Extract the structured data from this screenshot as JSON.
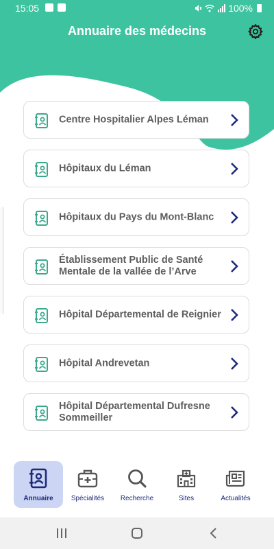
{
  "status_bar": {
    "time": "15:05",
    "battery": "100%"
  },
  "header": {
    "title": "Annuaire des médecins"
  },
  "colors": {
    "brand_green": "#3ec3a0",
    "navy": "#1e2a78",
    "icon_teal": "#3aa98b",
    "active_tab_bg": "#ccd5f3"
  },
  "hospitals": [
    {
      "label": "Centre Hospitalier Alpes Léman",
      "icon": "contact-book-icon"
    },
    {
      "label": "Hôpitaux du Léman",
      "icon": "contact-book-icon"
    },
    {
      "label": "Hôpitaux du Pays du Mont-Blanc",
      "icon": "contact-book-icon"
    },
    {
      "label": "Établissement Public de Santé Mentale de la vallée de l’Arve",
      "icon": "contact-book-icon"
    },
    {
      "label": "Hôpital Départemental de Reignier",
      "icon": "contact-book-icon"
    },
    {
      "label": "Hôpital Andrevetan",
      "icon": "contact-book-icon"
    },
    {
      "label": "Hôpital Départemental Dufresne Sommeiller",
      "icon": "contact-book-icon"
    }
  ],
  "bottom_nav": {
    "items": [
      {
        "label": "Annuaire",
        "icon": "contact-book-icon",
        "active": true
      },
      {
        "label": "Spécialités",
        "icon": "medical-case-icon",
        "active": false
      },
      {
        "label": "Recherche",
        "icon": "search-icon",
        "active": false
      },
      {
        "label": "Sites",
        "icon": "hospital-building-icon",
        "active": false
      },
      {
        "label": "Actualités",
        "icon": "newspaper-icon",
        "active": false
      }
    ]
  }
}
